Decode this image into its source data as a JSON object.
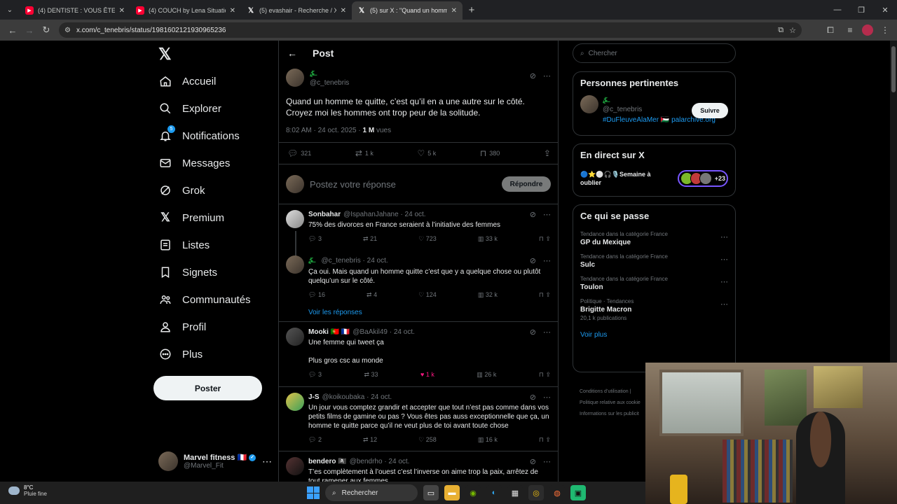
{
  "browser": {
    "tabs": [
      {
        "label": "(4) DENTISTE : VOUS ÊTES SALE",
        "favicon": "youtube-icon",
        "active": false
      },
      {
        "label": "(4) COUCH by Lena Situations",
        "favicon": "youtube-icon",
        "active": false
      },
      {
        "label": "(5) evashair - Recherche / X",
        "favicon": "x-icon",
        "active": false
      },
      {
        "label": "(5) sur X : \"Quand un homm",
        "favicon": "x-icon",
        "active": true
      }
    ],
    "url": "x.com/c_tenebris/status/1981602121930965236"
  },
  "leftnav": {
    "items": [
      {
        "label": "Accueil",
        "icon": "home-icon"
      },
      {
        "label": "Explorer",
        "icon": "search-icon"
      },
      {
        "label": "Notifications",
        "icon": "bell-icon",
        "badge": "5"
      },
      {
        "label": "Messages",
        "icon": "mail-icon"
      },
      {
        "label": "Grok",
        "icon": "grok-icon"
      },
      {
        "label": "Premium",
        "icon": "x-icon"
      },
      {
        "label": "Listes",
        "icon": "list-icon"
      },
      {
        "label": "Signets",
        "icon": "bookmark-icon"
      },
      {
        "label": "Communautés",
        "icon": "people-icon"
      },
      {
        "label": "Profil",
        "icon": "person-icon"
      },
      {
        "label": "Plus",
        "icon": "more-circle-icon"
      }
    ],
    "post_button": "Poster",
    "account": {
      "name": "Marvel fitness",
      "flag": "🇫🇷",
      "handle": "@Marvel_Fit"
    }
  },
  "main": {
    "header_title": "Post",
    "post": {
      "handle": "@c_tenebris",
      "text": "Quand un homme te quitte, c’est qu’il en a une autre sur le côté. Croyez moi les hommes ont trop peur de la solitude.",
      "time": "8:02 AM · 24 oct. 2025 · ",
      "views_count": "1 M",
      "views_label": " vues",
      "stats": {
        "replies": "321",
        "reposts": "1 k",
        "likes": "5 k",
        "bookmarks": "380"
      }
    },
    "reply_placeholder": "Postez votre réponse",
    "reply_button": "Répondre",
    "replies": [
      {
        "name": "Sonbahar",
        "handle": "@IspahanJahane · 24 oct.",
        "text": "75% des divorces en France seraient à l’initiative des femmes",
        "stats": [
          "3",
          "21",
          "723",
          "33 k"
        ]
      },
      {
        "name": "",
        "handle": "@c_tenebris · 24 oct.",
        "text": "Ça oui. Mais quand un homme quitte c’est que y a quelque chose ou plutôt quelqu’un sur le côté.",
        "stats": [
          "16",
          "4",
          "124",
          "32 k"
        ]
      },
      {
        "name": "Mooki 🇵🇹 🇫🇷",
        "handle": "@BaAkil49 · 24 oct.",
        "text": "Une femme qui tweet ça\n\nPlus gros csc au monde",
        "stats": [
          "3",
          "33",
          "1 k",
          "26 k"
        ]
      },
      {
        "name": "J-S",
        "handle": "@koikoubaka · 24 oct.",
        "text": "Un jour vous comptez grandir et accepter que tout n’est pas comme dans vos petits films de gamine ou pas ? Vous êtes pas auss exceptionnelle  que ça, un homme te quitte parce qu’il ne veut plus de toi avant toute chose",
        "stats": [
          "2",
          "12",
          "258",
          "16 k"
        ]
      },
      {
        "name": "bendero 🏴‍☠️",
        "handle": "@bendrho · 24 oct.",
        "text": "T’es complètement à l’ouest c’est l’inverse on aime trop la paix, arrêtez de tout ramener aux femmes",
        "stats": []
      }
    ],
    "see_replies": "Voir les réponses"
  },
  "right": {
    "search_placeholder": "Chercher",
    "relevant": {
      "title": "Personnes pertinentes",
      "handle": "@c_tenebris",
      "bio_tag": "#DuFleuveAlaMer",
      "bio_flag": "🇵🇸",
      "bio_link": "palarchive.org",
      "follow": "Suivre"
    },
    "live": {
      "title": "En direct sur X",
      "space_title": "🔵⭐⚪🎧🎙️Semaine à oublier",
      "count": "+23"
    },
    "trends": {
      "title": "Ce qui se passe",
      "items": [
        {
          "cat": "Tendance dans la catégorie France",
          "name": "GP du Mexique",
          "count": ""
        },
        {
          "cat": "Tendance dans la catégorie France",
          "name": "Sulc",
          "count": ""
        },
        {
          "cat": "Tendance dans la catégorie France",
          "name": "Toulon",
          "count": ""
        },
        {
          "cat": "Politique · Tendances",
          "name": "Brigitte Macron",
          "count": "20,1 k publications"
        }
      ],
      "see_more": "Voir plus"
    },
    "footer": [
      "Conditions d’utilisation  |",
      "Politique relative aux cookie",
      "Informations sur les publicit"
    ]
  },
  "taskbar": {
    "temp": "8°C",
    "weather": "Pluie fine",
    "search": "Rechercher"
  }
}
